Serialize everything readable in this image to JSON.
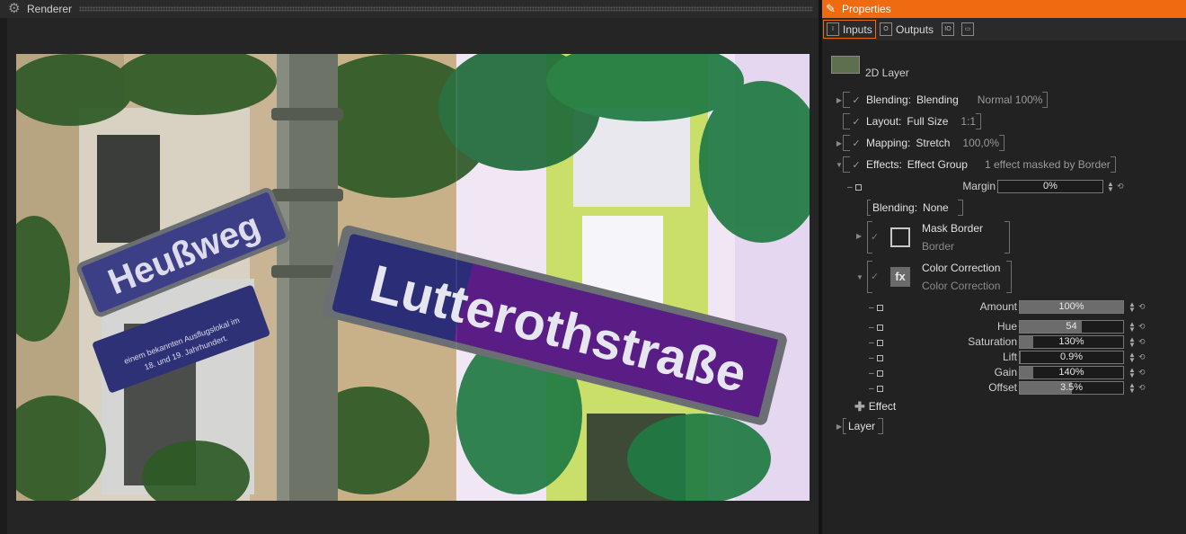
{
  "renderer": {
    "title": "Renderer"
  },
  "photo": {
    "sign_left_main": "Heußweg",
    "sign_left_sub": "nach dem ... HEUBHOF, einem bekannten Ausflugslokal im 18. und 19. Jahrhundert.",
    "sign_main": "Lutterothstraße"
  },
  "properties": {
    "title": "Properties",
    "tabs": [
      "Inputs",
      "Outputs"
    ],
    "layer_name": "2D Layer",
    "rows": {
      "blending": {
        "label": "Blending:",
        "value": "Blending",
        "detail": "Normal 100%"
      },
      "layout": {
        "label": "Layout:",
        "value": "Full Size",
        "detail": "1:1"
      },
      "mapping": {
        "label": "Mapping:",
        "value": "Stretch",
        "detail": "100,0%"
      },
      "effects": {
        "label": "Effects:",
        "value": "Effect Group",
        "detail": "1 effect masked by Border"
      }
    },
    "margin": {
      "label": "Margin",
      "value": "0%"
    },
    "inner_blending": {
      "label": "Blending:",
      "value": "None"
    },
    "mask_border": {
      "title": "Mask Border",
      "subtitle": "Border"
    },
    "color_correction": {
      "title": "Color Correction",
      "subtitle": "Color Correction",
      "icon": "fx"
    },
    "params": [
      {
        "label": "Amount",
        "value": "100%",
        "fill": 1.0
      },
      {
        "label": "Hue",
        "value": "54",
        "fill": 0.6
      },
      {
        "label": "Saturation",
        "value": "130%",
        "fill": 0.13
      },
      {
        "label": "Lift",
        "value": "0.9%",
        "fill": 0.01
      },
      {
        "label": "Gain",
        "value": "140%",
        "fill": 0.13
      },
      {
        "label": "Offset",
        "value": "3.5%",
        "fill": 0.5
      }
    ],
    "add_effect": "Effect",
    "layer_row": "Layer"
  }
}
